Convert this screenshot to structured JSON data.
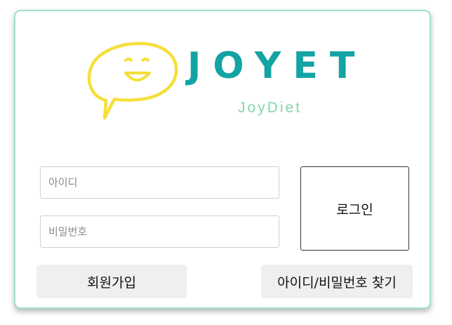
{
  "logo": {
    "wordmark": "JOYET",
    "tagline": "JoyDiet",
    "icon": "smiley-speech-bubble-icon",
    "colors": {
      "wordmark": "#14a3a3",
      "tagline": "#86d6a8",
      "bubble": "#f5df3a"
    }
  },
  "form": {
    "id_placeholder": "아이디",
    "id_value": "",
    "pw_placeholder": "비밀번호",
    "pw_value": "",
    "login_label": "로그인"
  },
  "actions": {
    "signup_label": "회원가입",
    "find_label": "아이디/비밀번호 찾기"
  },
  "theme": {
    "card_border": "#9fe0c6",
    "button_bg": "#efefef"
  }
}
